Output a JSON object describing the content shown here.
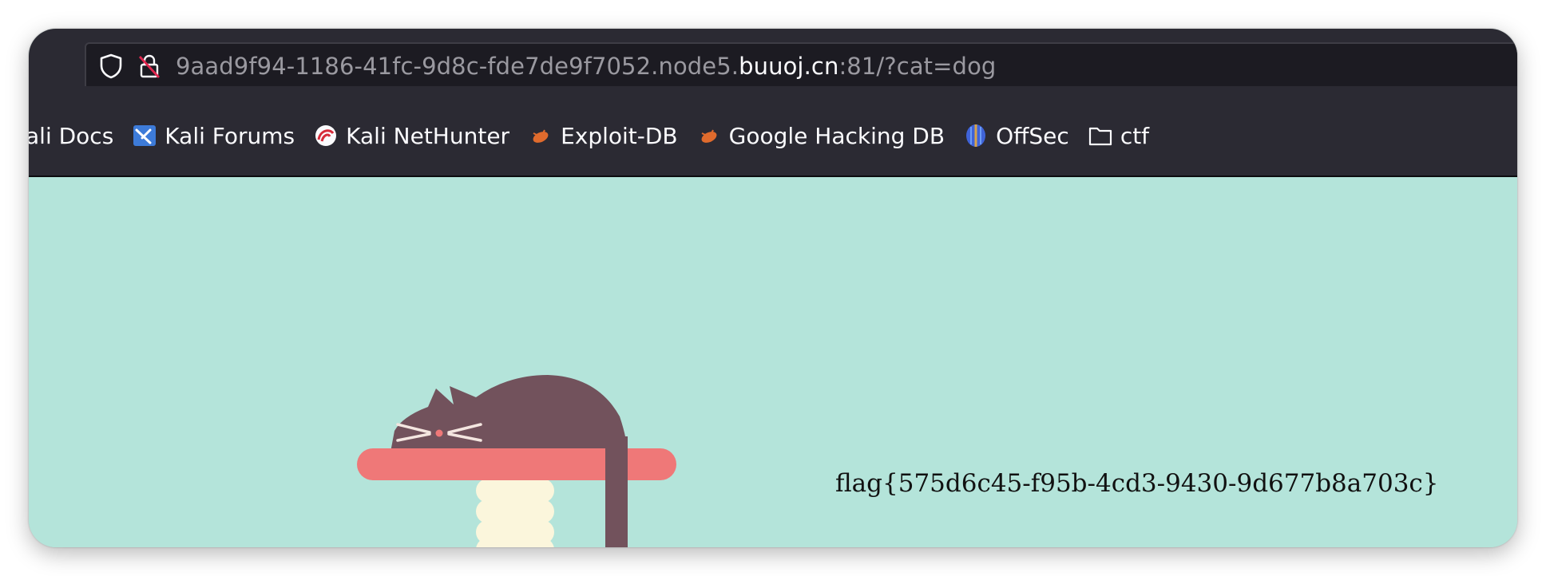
{
  "browser": {
    "url": {
      "prefix": "9aad9f94-1186-41fc-9d8c-fde7de9f7052.node5.",
      "domain": "buuoj.cn",
      "suffix": ":81/?cat=dog"
    },
    "bookmarks": [
      {
        "label": "ali Docs",
        "icon": "kali-docs-icon"
      },
      {
        "label": "Kali Forums",
        "icon": "kali-forums-icon"
      },
      {
        "label": "Kali NetHunter",
        "icon": "kali-nethunter-icon"
      },
      {
        "label": "Exploit-DB",
        "icon": "exploit-db-icon"
      },
      {
        "label": "Google Hacking DB",
        "icon": "google-hacking-db-icon"
      },
      {
        "label": "OffSec",
        "icon": "offsec-icon"
      },
      {
        "label": "ctf",
        "icon": "folder-icon"
      }
    ]
  },
  "page": {
    "flag_text": "flag{575d6c45-f95b-4cd3-9430-9d677b8a703c}",
    "background_color": "#b4e4da",
    "illustration": "sleeping-cat-on-cat-tree"
  },
  "colors": {
    "cat": "#72525c",
    "platform": "#ef7878",
    "post": "#fbf6dc",
    "whiskers": "#f4e6e0",
    "nose": "#ef7878"
  }
}
